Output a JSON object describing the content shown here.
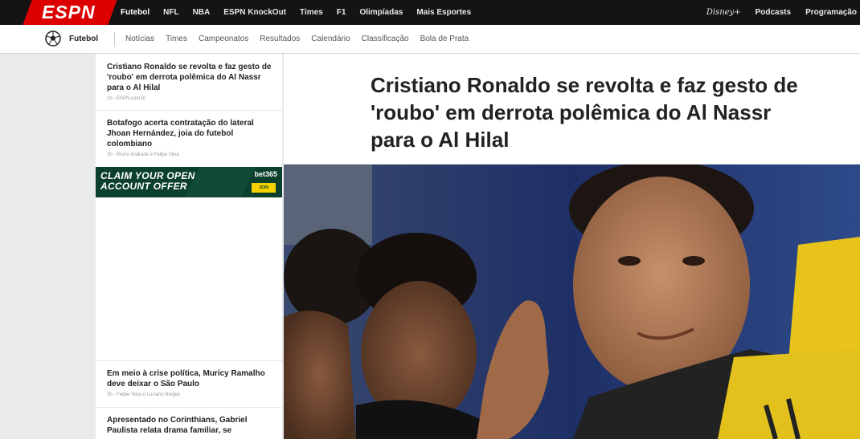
{
  "topnav": {
    "logo": "ESPN",
    "links": [
      "Futebol",
      "NFL",
      "NBA",
      "ESPN KnockOut",
      "Times",
      "F1",
      "Olimpíadas",
      "Mais Esportes"
    ],
    "right": {
      "disney": "Disney+",
      "podcasts": "Podcasts",
      "programacao": "Programação"
    }
  },
  "subnav": {
    "title": "Futebol",
    "links": [
      "Notícias",
      "Times",
      "Campeonatos",
      "Resultados",
      "Calendário",
      "Classificação",
      "Bola de Prata"
    ]
  },
  "sidebar": {
    "stories": [
      {
        "headline": "Cristiano Ronaldo se revolta e faz gesto de 'roubo' em derrota polêmica do Al Nassr para o Al Hilal",
        "meta": "1h - ESPN.com.br"
      },
      {
        "headline": "Botafogo acerta contratação do lateral Jhoan Hernández, joia do futebol colombiano",
        "meta": "2h - Bruno Andrade e Felipe Silva"
      },
      {
        "headline": "Em meio à crise política, Muricy Ramalho deve deixar o São Paulo",
        "meta": "3h - Felipe Silva e Luciano Borges"
      },
      {
        "headline": "Apresentado no Corinthians, Gabriel Paulista relata drama familiar, se",
        "meta": ""
      }
    ],
    "ad": {
      "line1": "CLAIM YOUR OPEN",
      "line2": "ACCOUNT OFFER",
      "brand": "bet365",
      "cta": "JOIN"
    }
  },
  "article": {
    "headline": "Cristiano Ronaldo se revolta e faz gesto de 'roubo' em derrota polêmica do Al Nassr para o Al Hilal"
  },
  "colors": {
    "espn_red": "#dd0000",
    "nav_bg": "#141414",
    "ad_green": "#0b3f2e",
    "ad_yellow": "#f6d100"
  }
}
